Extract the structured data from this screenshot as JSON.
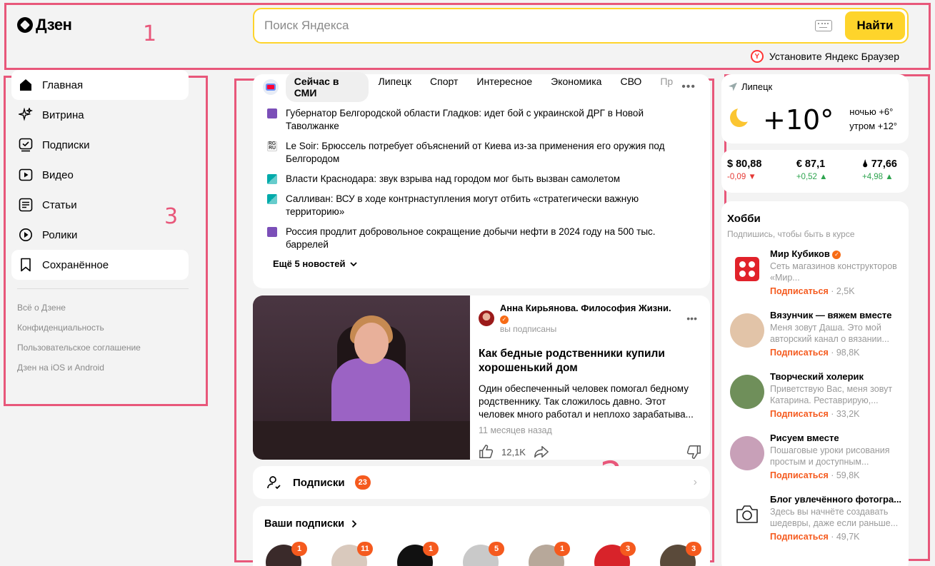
{
  "header": {
    "logo": "Дзен",
    "search_placeholder": "Поиск Яндекса",
    "search_button": "Найти",
    "browser_promo": "Установите Яндекс Браузер"
  },
  "sidebar": {
    "items": [
      {
        "label": "Главная",
        "icon": "home-icon",
        "active": true
      },
      {
        "label": "Витрина",
        "icon": "sparkle-icon"
      },
      {
        "label": "Подписки",
        "icon": "subscriptions-icon"
      },
      {
        "label": "Видео",
        "icon": "video-icon"
      },
      {
        "label": "Статьи",
        "icon": "article-icon"
      },
      {
        "label": "Ролики",
        "icon": "clips-icon"
      },
      {
        "label": "Сохранённое",
        "icon": "bookmark-icon",
        "active": true
      }
    ],
    "footer_links": [
      "Всё о Дзене",
      "Конфиденциальность",
      "Пользовательское соглашение",
      "Дзен на iOS и Android"
    ]
  },
  "news": {
    "tabs": [
      {
        "label": "Сейчас в СМИ",
        "selected": true
      },
      {
        "label": "Липецк"
      },
      {
        "label": "Спорт"
      },
      {
        "label": "Интересное"
      },
      {
        "label": "Экономика"
      },
      {
        "label": "СВО"
      },
      {
        "label": "Пр",
        "faded": true
      }
    ],
    "items": [
      {
        "source_icon": "purple",
        "text": "Губернатор Белгородской области Гладков: идет бой с украинской ДРГ в Новой Таволжанке"
      },
      {
        "source_icon": "rg",
        "text": "Le Soir: Брюссель потребует объяснений от Киева из-за применения его оружия под Белгородом"
      },
      {
        "source_icon": "teal",
        "text": "Власти Краснодара: звук взрыва над городом мог быть вызван самолетом"
      },
      {
        "source_icon": "teal",
        "text": "Салливан: ВСУ в ходе контрнаступления могут отбить «стратегически важную территорию»"
      },
      {
        "source_icon": "purple",
        "text": "Россия продлит добровольное сокращение добычи нефти в 2024 году на 500 тыс. баррелей"
      }
    ],
    "more_label": "Ещё 5 новостей"
  },
  "article": {
    "author": "Анна Кирьянова. Философия Жизни.",
    "author_status": "вы подписаны",
    "title": "Как бедные родственники купили хорошенький дом",
    "text": "Один обеспеченный человек помогал бедному родственнику. Так сложилось давно. Этот человек много работал и неплохо зарабатыва...",
    "time": "11 месяцев назад",
    "likes": "12,1K"
  },
  "subscriptions_bar": {
    "label": "Подписки",
    "count": "23"
  },
  "your_subs": {
    "title": "Ваши подписки",
    "items": [
      {
        "count": "1",
        "color": "#3a2a2a"
      },
      {
        "count": "11",
        "color": "#d9c9bd"
      },
      {
        "count": "1",
        "color": "#111111"
      },
      {
        "count": "5",
        "color": "#c9c9c9"
      },
      {
        "count": "1",
        "color": "#b7a89a"
      },
      {
        "count": "3",
        "color": "#d8232a"
      },
      {
        "count": "3",
        "color": "#5a4a3a"
      }
    ]
  },
  "weather": {
    "city": "Липецк",
    "temp": "+10°",
    "night": "ночью +6°",
    "morning": "утром +12°"
  },
  "rates": [
    {
      "value": "$ 80,88",
      "change": "-0,09 ▼",
      "direction": "down"
    },
    {
      "value": "€ 87,1",
      "change": "+0,52 ▲",
      "direction": "up"
    },
    {
      "value": "🌢 77,66",
      "change": "+4,98 ▲",
      "direction": "up"
    }
  ],
  "hobby": {
    "title": "Хобби",
    "subtitle": "Подпишись, чтобы быть в курсе",
    "subscribe_label": "Подписаться",
    "channels": [
      {
        "name": "Мир Кубиков",
        "verified": true,
        "desc": "Сеть магазинов конструкторов «Мир...",
        "count": "2,5K",
        "avatar": "dice"
      },
      {
        "name": "Вязунчик — вяжем вместе",
        "desc": "Меня зовут Даша. Это мой авторский канал о вязании...",
        "count": "98,8K",
        "avatar": "#e2c4a8"
      },
      {
        "name": "Творческий холерик",
        "desc": "Приветствую Вас, меня зовут Катарина. Реставрирую,...",
        "count": "33,2K",
        "avatar": "#6f8f5a"
      },
      {
        "name": "Рисуем вместе",
        "desc": "Пошаговые уроки рисования простым и доступным...",
        "count": "59,8K",
        "avatar": "#c8a0b8"
      },
      {
        "name": "Блог увлечённого фотогра...",
        "desc": "Здесь вы начнёте создавать шедевры, даже если раньше...",
        "count": "49,7K",
        "avatar": "camera"
      }
    ]
  },
  "annotations": [
    "1",
    "2",
    "3",
    "3"
  ],
  "colors": {
    "accent": "#fed42b",
    "annotation": "#e8577a",
    "subscribe": "#f55a1e"
  }
}
